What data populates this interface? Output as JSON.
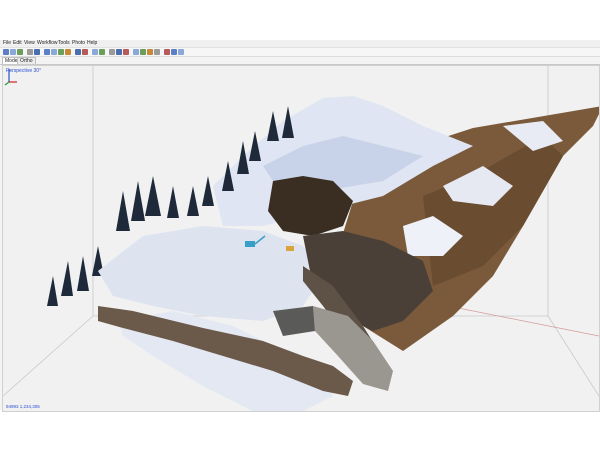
{
  "menubar": {
    "items": [
      "File",
      "Edit",
      "View",
      "Workflow",
      "Tools",
      "Photo",
      "Help"
    ]
  },
  "toolbar": {
    "icons": [
      "new-icon",
      "open-icon",
      "save-icon",
      "sep",
      "undo-icon",
      "redo-icon",
      "sep",
      "select-icon",
      "rect-select-icon",
      "circle-select-icon",
      "free-select-icon",
      "sep",
      "navigate-icon",
      "crop-icon",
      "sep",
      "rotate-icon",
      "resize-icon",
      "sep",
      "zoom-in-icon",
      "zoom-out-icon",
      "zoom-fit-icon",
      "sep",
      "points-icon",
      "dense-icon",
      "mesh-icon",
      "texture-icon",
      "sep",
      "grid-icon",
      "camera-icon",
      "axis-icon"
    ]
  },
  "tabs": [
    {
      "label": "Model",
      "active": true
    },
    {
      "label": "Ortho",
      "active": false
    }
  ],
  "viewport": {
    "perspective_label": "Perspective 30°",
    "status_label": "94993 1,234,305"
  },
  "colors": {
    "label_blue": "#2a4fd0",
    "snow": "#eef1f8",
    "soil": "#7a5a3a",
    "tree": "#1e2a3a"
  }
}
